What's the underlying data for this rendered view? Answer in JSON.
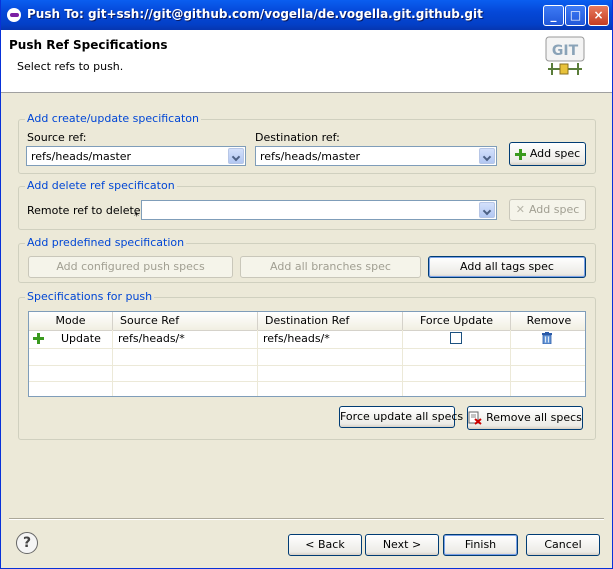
{
  "window": {
    "title": "Push To: git+ssh://git@github.com/vogella/de.vogella.git.github.git"
  },
  "banner": {
    "heading": "Push Ref Specifications",
    "subtitle": "Select refs to push.",
    "logo_text": "GIT"
  },
  "create_group": {
    "legend": "Add create/update specificaton",
    "source_label": "Source ref:",
    "source_value": "refs/heads/master",
    "dest_label": "Destination ref:",
    "dest_value": "refs/heads/master",
    "add_button": "Add spec"
  },
  "delete_group": {
    "legend": "Add delete ref specificaton",
    "remote_label": "Remote ref to delete:",
    "required_marker": "*",
    "remote_value": "",
    "add_button": "Add spec"
  },
  "predefined_group": {
    "legend": "Add predefined specification",
    "configured_button": "Add configured push specs",
    "branches_button": "Add all branches spec",
    "tags_button": "Add all tags spec"
  },
  "specs_group": {
    "legend": "Specifications for push",
    "columns": [
      "Mode",
      "Source Ref",
      "Destination Ref",
      "Force Update",
      "Remove"
    ],
    "rows": [
      {
        "mode": "Update",
        "source": "refs/heads/*",
        "dest": "refs/heads/*",
        "force": false
      }
    ],
    "force_all_button": "Force update all specs",
    "remove_all_button": "Remove all specs"
  },
  "footer": {
    "help": "?",
    "back_button": "< Back",
    "next_button": "Next >",
    "finish_button": "Finish",
    "cancel_button": "Cancel"
  },
  "window_controls": {
    "minimize": "_",
    "maximize": "□",
    "close": "×"
  }
}
